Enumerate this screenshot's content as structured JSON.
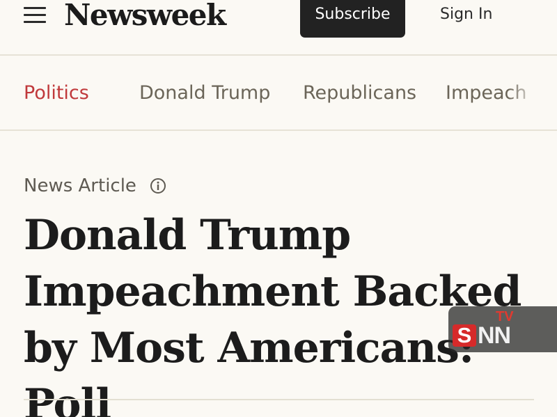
{
  "header": {
    "logo": "Newsweek",
    "subscribe_label": "Subscribe",
    "signin_label": "Sign In"
  },
  "nav": {
    "items": [
      {
        "label": "Politics",
        "active": true
      },
      {
        "label": "Donald Trump",
        "active": false
      },
      {
        "label": "Republicans",
        "active": false
      },
      {
        "label": "Impeach",
        "active": false
      }
    ]
  },
  "article": {
    "type_label": "News Article",
    "headline": "Donald Trump Impeachment Backed by Most Americans: Poll"
  },
  "watermark": {
    "s": "S",
    "nn": "NN",
    "tv": "TV"
  },
  "colors": {
    "background": "#fbf9f4",
    "active_category": "#c0393b",
    "subscribe_bg": "#222222"
  },
  "icons": {
    "menu": "hamburger-menu-icon",
    "info": "info-circle-icon"
  }
}
